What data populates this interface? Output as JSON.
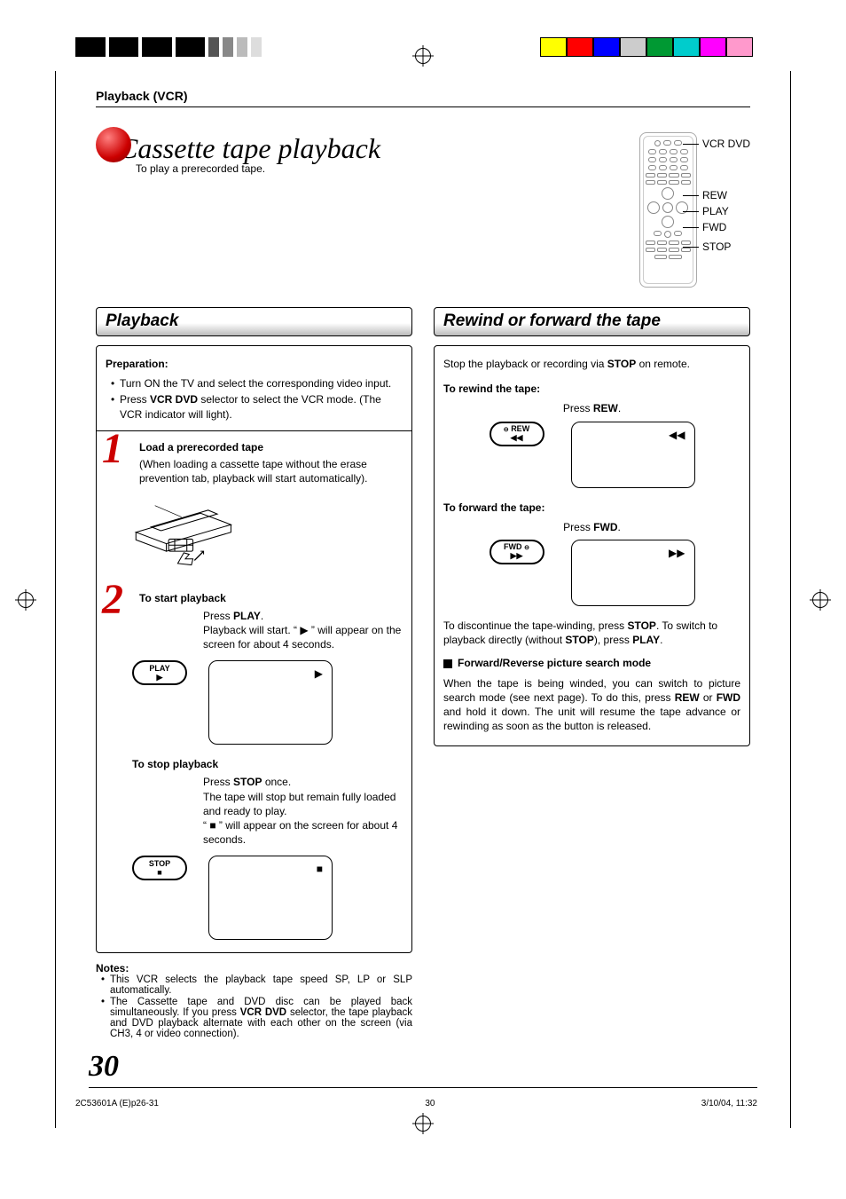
{
  "breadcrumb": "Playback (VCR)",
  "title": "Cassette tape playback",
  "subtitle": "To play a prerecorded tape.",
  "remote_labels": {
    "vcr_dvd": "VCR DVD",
    "rew": "REW",
    "play": "PLAY",
    "fwd": "FWD",
    "stop": "STOP"
  },
  "playback": {
    "heading": "Playback",
    "prep_title": "Preparation:",
    "prep_items": [
      "Turn ON the TV and select the corresponding video input.",
      "Press <b>VCR DVD</b> selector to select the VCR mode. (The VCR indicator will light)."
    ],
    "step1": {
      "num": "1",
      "title": "Load a prerecorded tape",
      "body": "(When loading a cassette tape without the erase prevention tab, playback will start automatically)."
    },
    "step2": {
      "num": "2",
      "title": "To start playback",
      "press_play_line": "Press <b>PLAY</b>.",
      "play_desc": "Playback will start. “ ▶ ” will appear on the screen for about 4 seconds.",
      "play_btn": "PLAY",
      "stop_title": "To stop playback",
      "stop_press": "Press <b>STOP</b> once.",
      "stop_desc1": "The tape will stop but remain fully loaded and ready to play.",
      "stop_desc2": "“ ■ ” will appear on the screen for about 4 seconds.",
      "stop_btn": "STOP"
    }
  },
  "notes": {
    "title": "Notes:",
    "items": [
      "This VCR selects the playback tape speed SP, LP or SLP automatically.",
      "The Cassette tape and DVD disc can be played back simultaneously. If you press <b>VCR DVD</b> selector, the tape playback and DVD playback alternate with each other on the screen (via CH3, 4 or video connection)."
    ]
  },
  "rewind": {
    "heading": "Rewind or forward the tape",
    "intro": "Stop the playback or recording via <b>STOP</b> on remote.",
    "rew_title": "To rewind the tape:",
    "rew_press": "Press <b>REW</b>.",
    "rew_btn": "REW",
    "fwd_title": "To forward the tape:",
    "fwd_press": "Press <b>FWD</b>.",
    "fwd_btn": "FWD",
    "discontinue": "To discontinue the tape-winding, press <b>STOP</b>. To switch to playback directly (without <b>STOP</b>), press <b>PLAY</b>.",
    "search_title": "Forward/Reverse picture search mode",
    "search_body": "When the tape is being winded, you can switch to picture search mode (see next page). To do this, press <b>REW</b> or <b>FWD</b> and hold it down. The unit will resume the tape advance or rewinding as soon as the button is released."
  },
  "page_number": "30",
  "footer": {
    "doc_id": "2C53601A (E)p26-31",
    "page": "30",
    "stamp": "3/10/04, 11:32"
  },
  "colors": [
    "#ffff00",
    "#ff0000",
    "#0000ff",
    "#cccccc",
    "#009933",
    "#00cccc",
    "#ff00ff",
    "#ff99cc"
  ]
}
